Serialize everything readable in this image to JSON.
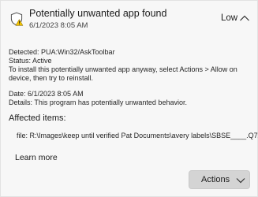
{
  "notification": {
    "title": "Potentially unwanted app found",
    "timestamp": "6/1/2023 8:05 AM",
    "severity": "Low"
  },
  "details": {
    "detected": "Detected:  PUA:Win32/AskToolbar",
    "status": "Status:  Active",
    "instruction": "To install this potentially unwanted app anyway, select Actions > Allow on device, then try to reinstall.",
    "date": "Date:  6/1/2023 8:05 AM",
    "description": "Details:  This program has potentially unwanted behavior."
  },
  "affected": {
    "heading": "Affected items:",
    "file": "file: R:\\Images\\keep until verified Pat Documents\\avery labels\\SBSE____.Q7Z"
  },
  "links": {
    "learn_more": "Learn more"
  },
  "actions": {
    "label": "Actions"
  },
  "colors": {
    "warning_yellow": "#f2c200",
    "card_background": "#f7f7f7",
    "button_background": "#d4d4d4"
  },
  "icons": {
    "shield": "shield-warning-icon",
    "collapse": "chevron-up-icon",
    "dropdown": "chevron-down-icon"
  }
}
